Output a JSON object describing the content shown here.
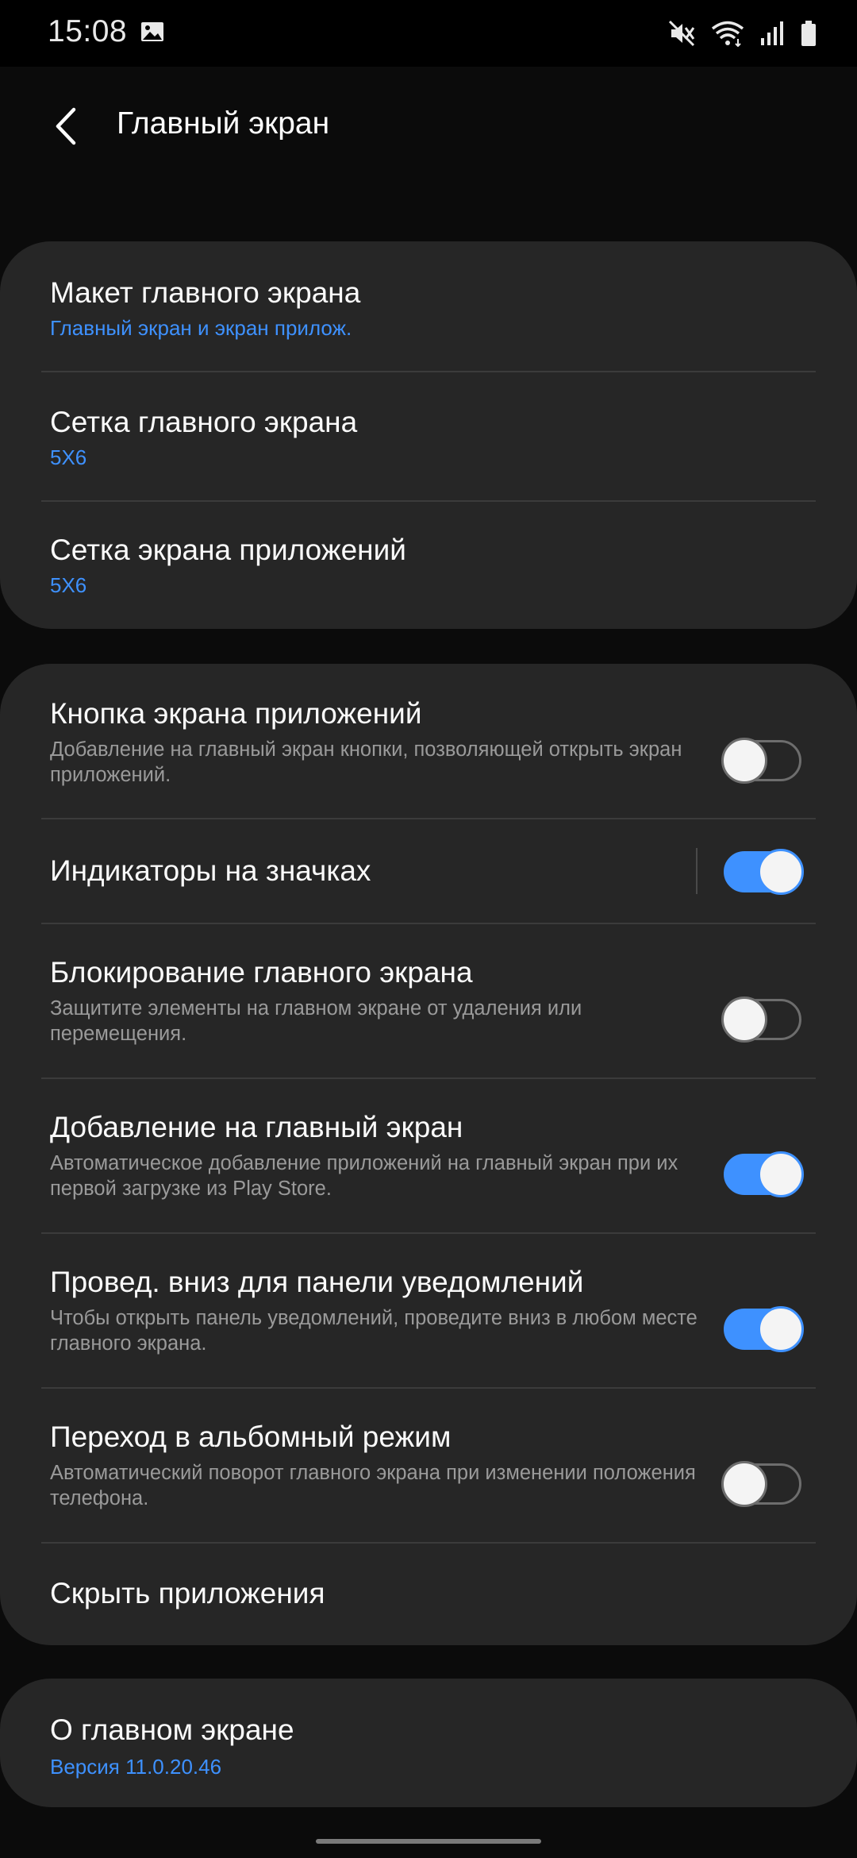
{
  "status_bar": {
    "time": "15:08",
    "left_icons": [
      "gallery-icon"
    ],
    "right_icons": [
      "mute-icon",
      "wifi-icon",
      "signal-icon",
      "battery-icon"
    ]
  },
  "header": {
    "back_icon": "chevron-left-icon",
    "title": "Главный экран"
  },
  "card1": {
    "items": [
      {
        "title": "Макет главного экрана",
        "value": "Главный экран и экран прилож."
      },
      {
        "title": "Сетка главного экрана",
        "value": "5X6"
      },
      {
        "title": "Сетка экрана приложений",
        "value": "5X6"
      }
    ]
  },
  "card2": {
    "items": [
      {
        "title": "Кнопка экрана приложений",
        "description": "Добавление на главный экран кнопки, позволяющей открыть экран приложений.",
        "enabled": false
      },
      {
        "title": "Индикаторы на значках",
        "enabled": true
      },
      {
        "title": "Блокирование главного экрана",
        "description": "Защитите элементы на главном экране от удаления или перемещения.",
        "enabled": false
      },
      {
        "title": "Добавление на главный экран",
        "description": "Автоматическое добавление приложений на главный экран при их первой загрузке из Play Store.",
        "enabled": true
      },
      {
        "title": "Провед. вниз для панели уведомлений",
        "description": "Чтобы открыть панель уведомлений, проведите вниз в любом месте главного экрана.",
        "enabled": true
      },
      {
        "title": "Переход в альбомный режим",
        "description": "Автоматический поворот главного экрана при изменении положения телефона.",
        "enabled": false
      },
      {
        "title": "Скрыть приложения"
      }
    ]
  },
  "card3": {
    "title": "О главном экране",
    "version": "Версия 11.0.20.46"
  },
  "colors": {
    "background": "#0b0b0b",
    "card": "#262626",
    "accent": "#3e91ff",
    "secondary_text": "#9a9a9a",
    "divider": "#3b3b3b"
  }
}
